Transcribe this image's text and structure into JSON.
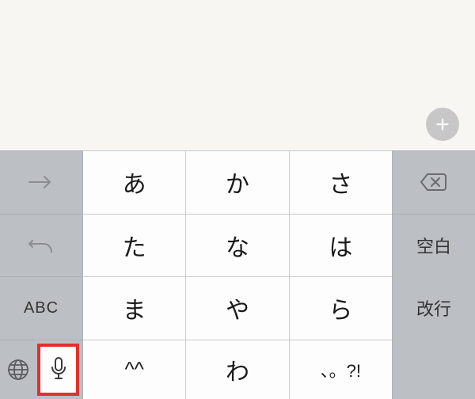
{
  "keyboard": {
    "rows": {
      "r1": {
        "k1": "あ",
        "k2": "か",
        "k3": "さ"
      },
      "r2": {
        "k1": "た",
        "k2": "な",
        "k3": "は"
      },
      "r3": {
        "k1": "ま",
        "k2": "や",
        "k3": "ら"
      },
      "r4": {
        "k1": "^^",
        "k2": "わ",
        "k3": "、。?!"
      }
    },
    "left": {
      "abc": "ABC"
    },
    "right": {
      "space": "空白",
      "return": "改行"
    }
  }
}
